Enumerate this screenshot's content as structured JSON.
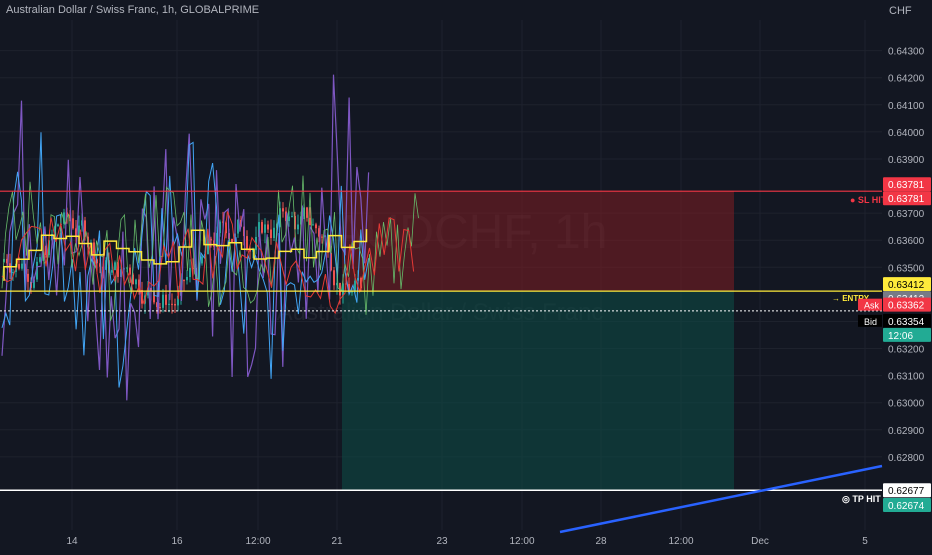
{
  "header": {
    "title": "Australian Dollar / Swiss Franc, 1h, GLOBALPRIME",
    "currency": "CHF"
  },
  "watermark": {
    "symbol": "AUDCHF, 1h",
    "name": "Australian Dollar / Swiss Franc"
  },
  "colors": {
    "background": "#131722",
    "grid": "#1e222d",
    "axis_text": "#b2b5be",
    "sl_zone": "#7f1d22",
    "tp_zone": "#0d4a44",
    "sl_line": "#f23645",
    "entry_line": "#ffeb3b",
    "tp_line": "#ffffff",
    "trend_line": "#2962ff",
    "bid_label": "#000000",
    "ask_label": "#f23645",
    "countdown_label": "#22ab94"
  },
  "chart_data": {
    "type": "candlestick",
    "symbol": "AUDCHF",
    "timeframe": "1h",
    "y_axis_ticks": [
      "0.64300",
      "0.64200",
      "0.64100",
      "0.64000",
      "0.63900",
      "0.63700",
      "0.63600",
      "0.63500",
      "0.63300",
      "0.63200",
      "0.63100",
      "0.63000",
      "0.62900",
      "0.62800"
    ],
    "y_tick_values": [
      0.643,
      0.642,
      0.641,
      0.64,
      0.639,
      0.637,
      0.636,
      0.635,
      0.633,
      0.632,
      0.631,
      0.63,
      0.629,
      0.628
    ],
    "ylim": [
      0.6253,
      0.6445
    ],
    "x_axis_ticks": [
      "14",
      "16",
      "12:00",
      "21",
      "23",
      "12:00",
      "28",
      "12:00",
      "Dec",
      "5"
    ],
    "x_tick_positions": [
      72,
      177,
      258,
      337,
      442,
      522,
      601,
      681,
      760,
      865
    ],
    "price_levels": {
      "stop_loss": 0.63781,
      "current_top": 0.63412,
      "entry": 0.63362,
      "bid": 0.63354,
      "take_profit_upper": 0.62677,
      "take_profit": 0.62674
    },
    "labels": {
      "sl_hit": "SL HIT",
      "entry": "ENTRY",
      "tp_hit": "TP HIT",
      "ask": "Ask",
      "bid": "Bid",
      "countdown": "12:06"
    },
    "axis_price_labels": [
      {
        "text": "0.63781",
        "bg": "#f23645",
        "fg": "#ffffff",
        "price": 0.63781,
        "offset": -7
      },
      {
        "text": "0.63781",
        "bg": "#f23645",
        "fg": "#ffffff",
        "price": 0.63781,
        "offset": 7
      },
      {
        "text": "0.63412",
        "bg": "#ffeb3b",
        "fg": "#000000",
        "price": 0.63412,
        "offset": -7
      },
      {
        "text": "0.63412",
        "bg": "#787b86",
        "fg": "#ffffff",
        "price": 0.63412,
        "offset": 7
      },
      {
        "text": "0.63362",
        "bg": "#f23645",
        "fg": "#ffffff",
        "price": 0.63362,
        "offset": 0
      },
      {
        "text": "0.63354",
        "bg": "#000000",
        "fg": "#ffffff",
        "price": 0.63354,
        "offset": 14
      },
      {
        "text": "12:06",
        "bg": "#22ab94",
        "fg": "#ffffff",
        "price": 0.63354,
        "offset": 28
      },
      {
        "text": "0.62677",
        "bg": "#ffffff",
        "fg": "#000000",
        "price": 0.62677,
        "offset": 0
      },
      {
        "text": "0.62674",
        "bg": "#22ab94",
        "fg": "#ffffff",
        "price": 0.62674,
        "offset": 14
      }
    ]
  }
}
